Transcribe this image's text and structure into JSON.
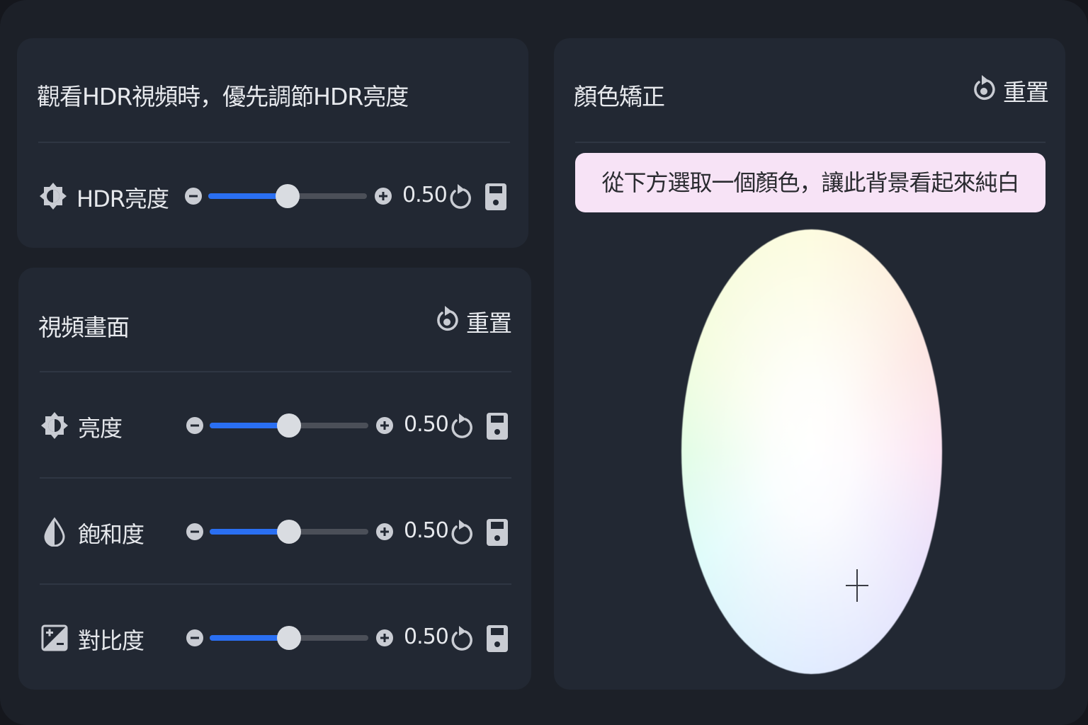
{
  "hdr_panel": {
    "title": "觀看HDR視頻時，優先調節HDR亮度",
    "rows": [
      {
        "label": "HDR亮度",
        "icon": "hdr-brightness-icon",
        "value_text": "0.50",
        "value": 0.5
      }
    ]
  },
  "video_panel": {
    "title": "視頻畫面",
    "reset_label": "重置",
    "rows": [
      {
        "label": "亮度",
        "icon": "brightness-icon",
        "value_text": "0.50",
        "value": 0.5
      },
      {
        "label": "飽和度",
        "icon": "saturation-drop-icon",
        "value_text": "0.50",
        "value": 0.5
      },
      {
        "label": "對比度",
        "icon": "contrast-icon",
        "value_text": "0.50",
        "value": 0.5
      }
    ]
  },
  "color_panel": {
    "title": "顏色矯正",
    "reset_label": "重置",
    "banner": "從下方選取一個顏色，讓此背景看起來純白"
  },
  "colors": {
    "accent": "#2a6ff2",
    "card": "#222833",
    "banner": "#f7e3f6"
  }
}
